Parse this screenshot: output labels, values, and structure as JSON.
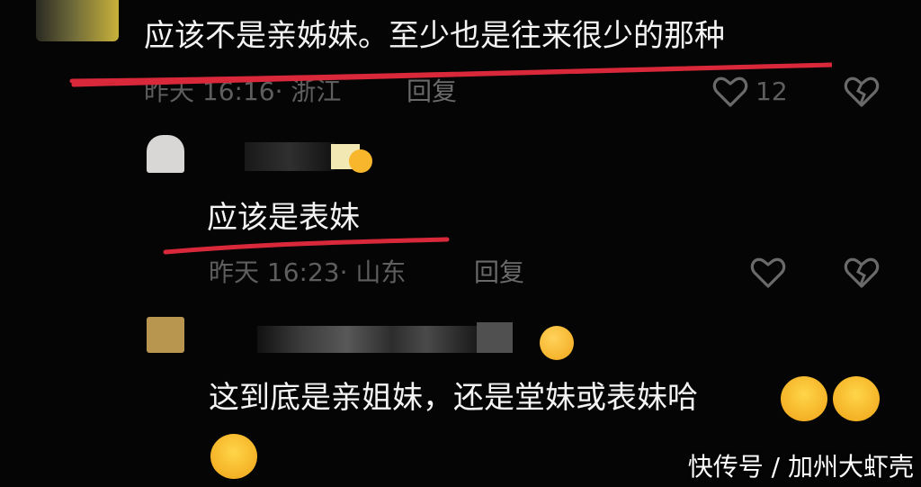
{
  "comments": [
    {
      "text": "应该不是亲姊妹。至少也是往来很少的那种",
      "meta": "昨天 16:16· 浙江",
      "reply_label": "回复",
      "like_count": "12"
    },
    {
      "text": "应该是表妹",
      "meta": "昨天 16:23· 山东",
      "reply_label": "回复"
    },
    {
      "text_line1": "这到底是亲姐妹，还是堂妹或表妹哈"
    }
  ],
  "watermark": "快传号 / 加州大虾壳",
  "colors": {
    "background": "#050505",
    "text": "#f4f4f4",
    "meta": "#5e5e5e",
    "annotation_red": "#d9283a"
  },
  "icons": [
    "heart-icon",
    "broken-heart-icon",
    "laughing-crying-emoji",
    "smile-emoji"
  ]
}
